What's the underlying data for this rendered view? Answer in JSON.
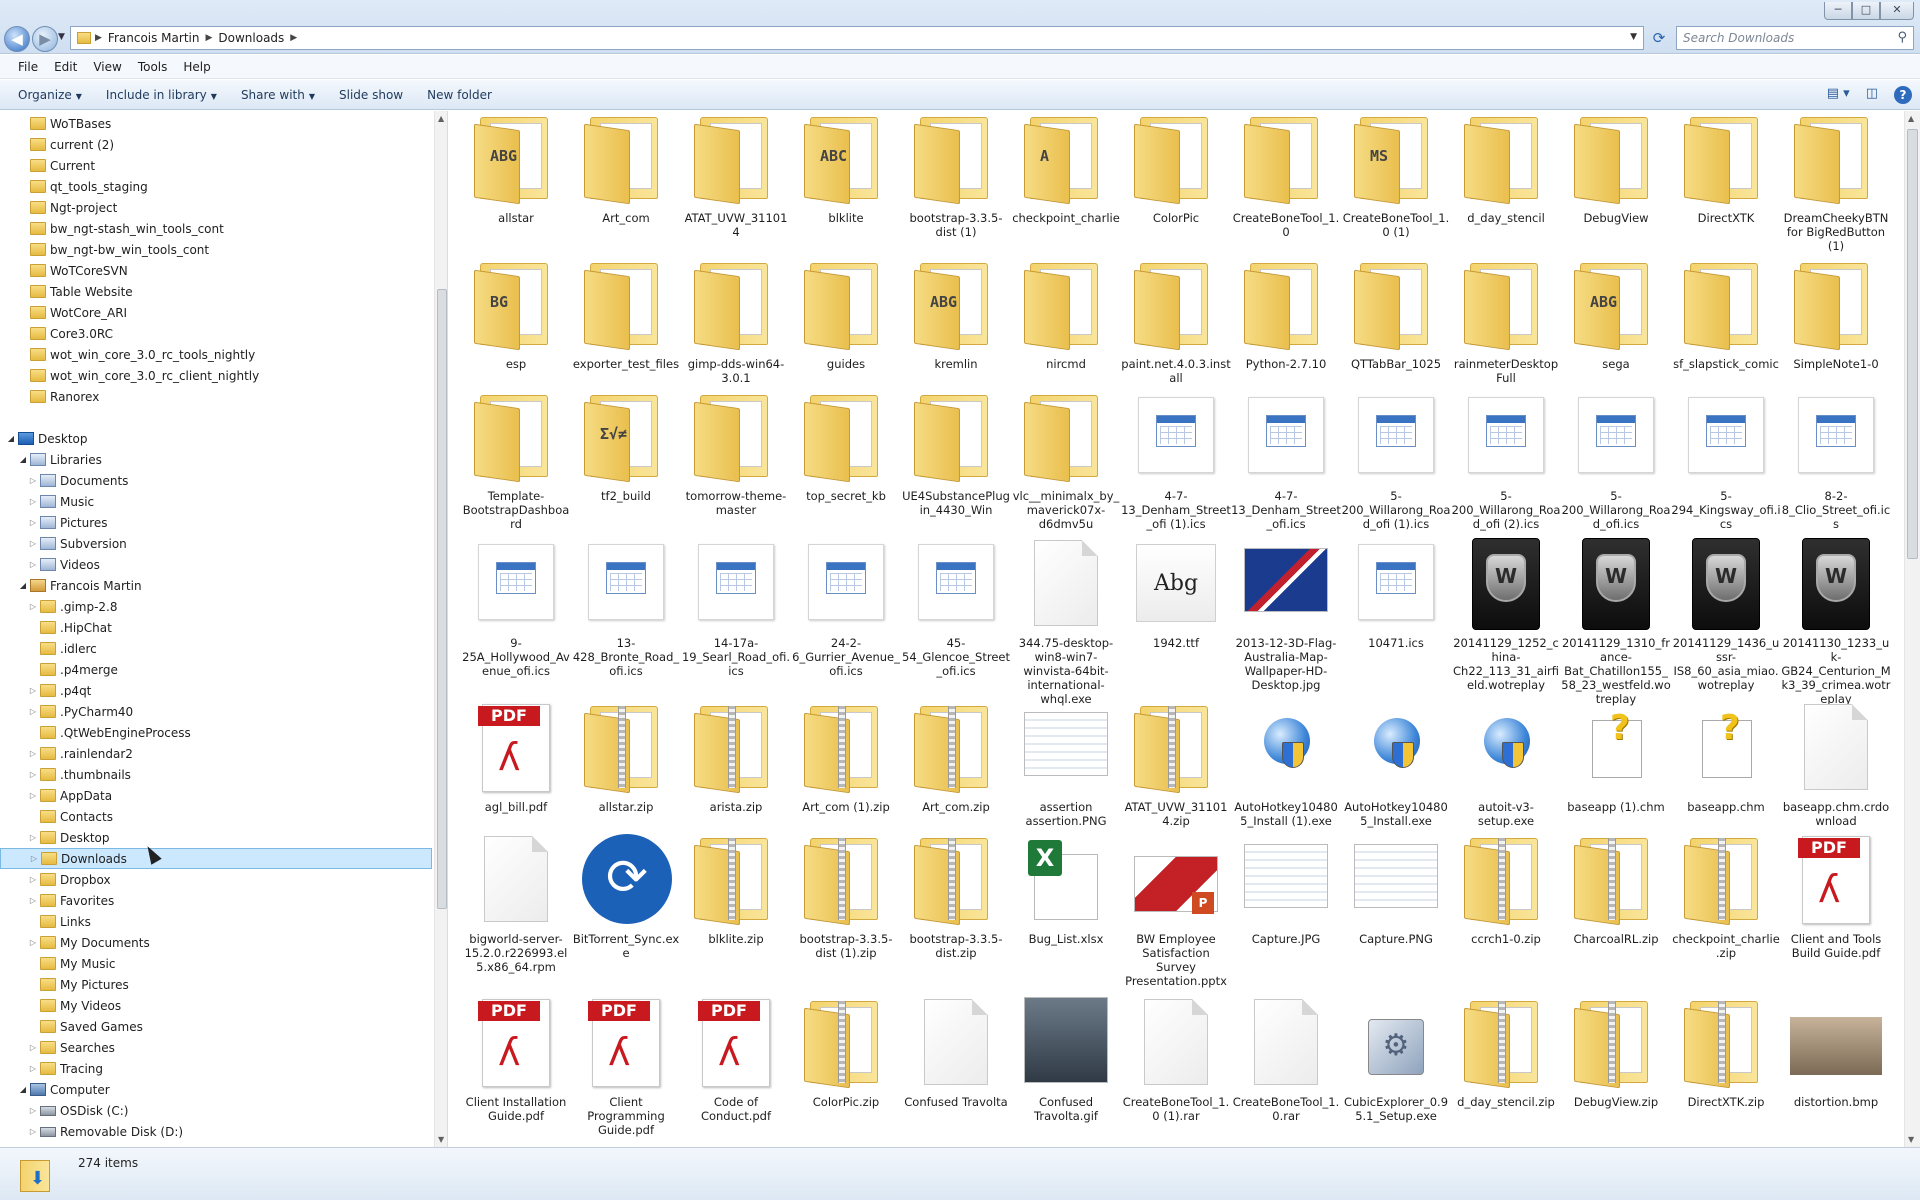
{
  "window": {
    "breadcrumb": [
      "Francois Martin",
      "Downloads"
    ],
    "search_placeholder": "Search Downloads",
    "controls": {
      "minimize": "─",
      "maximize": "□",
      "close": "✕"
    }
  },
  "menubar": [
    "File",
    "Edit",
    "View",
    "Tools",
    "Help"
  ],
  "commandbar": {
    "organize": "Organize",
    "include": "Include in library",
    "share": "Share with",
    "slideshow": "Slide show",
    "newfolder": "New folder"
  },
  "navpane": {
    "selected": "Downloads",
    "items": [
      {
        "label": "WoTBases",
        "level": 1,
        "icon": "folder",
        "arrow": ""
      },
      {
        "label": "current (2)",
        "level": 1,
        "icon": "folder",
        "arrow": ""
      },
      {
        "label": "Current",
        "level": 1,
        "icon": "folder",
        "arrow": ""
      },
      {
        "label": "qt_tools_staging",
        "level": 1,
        "icon": "folder",
        "arrow": ""
      },
      {
        "label": "Ngt-project",
        "level": 1,
        "icon": "folder",
        "arrow": ""
      },
      {
        "label": "bw_ngt-stash_win_tools_cont",
        "level": 1,
        "icon": "folder",
        "arrow": ""
      },
      {
        "label": "bw_ngt-bw_win_tools_cont",
        "level": 1,
        "icon": "folder",
        "arrow": ""
      },
      {
        "label": "WoTCoreSVN",
        "level": 1,
        "icon": "folder",
        "arrow": ""
      },
      {
        "label": "Table Website",
        "level": 1,
        "icon": "folder",
        "arrow": ""
      },
      {
        "label": "WotCore_ARI",
        "level": 1,
        "icon": "folder",
        "arrow": ""
      },
      {
        "label": "Core3.0RC",
        "level": 1,
        "icon": "folder",
        "arrow": ""
      },
      {
        "label": "wot_win_core_3.0_rc_tools_nightly",
        "level": 1,
        "icon": "folder",
        "arrow": ""
      },
      {
        "label": "wot_win_core_3.0_rc_client_nightly",
        "level": 1,
        "icon": "folder",
        "arrow": ""
      },
      {
        "label": "Ranorex",
        "level": 1,
        "icon": "folder",
        "arrow": ""
      },
      {
        "label": "",
        "level": 0,
        "icon": "",
        "arrow": ""
      },
      {
        "label": "Desktop",
        "level": 0,
        "icon": "desk",
        "arrow": "open"
      },
      {
        "label": "Libraries",
        "level": 1,
        "icon": "lib",
        "arrow": "open"
      },
      {
        "label": "Documents",
        "level": 2,
        "icon": "lib",
        "arrow": "closed"
      },
      {
        "label": "Music",
        "level": 2,
        "icon": "lib",
        "arrow": "closed"
      },
      {
        "label": "Pictures",
        "level": 2,
        "icon": "lib",
        "arrow": "closed"
      },
      {
        "label": "Subversion",
        "level": 2,
        "icon": "lib",
        "arrow": "closed"
      },
      {
        "label": "Videos",
        "level": 2,
        "icon": "lib",
        "arrow": "closed"
      },
      {
        "label": "Francois Martin",
        "level": 1,
        "icon": "user",
        "arrow": "open"
      },
      {
        "label": ".gimp-2.8",
        "level": 2,
        "icon": "folder",
        "arrow": "closed"
      },
      {
        "label": ".HipChat",
        "level": 2,
        "icon": "folder",
        "arrow": ""
      },
      {
        "label": ".idlerc",
        "level": 2,
        "icon": "folder",
        "arrow": ""
      },
      {
        "label": ".p4merge",
        "level": 2,
        "icon": "folder",
        "arrow": ""
      },
      {
        "label": ".p4qt",
        "level": 2,
        "icon": "folder",
        "arrow": "closed"
      },
      {
        "label": ".PyCharm40",
        "level": 2,
        "icon": "folder",
        "arrow": "closed"
      },
      {
        "label": ".QtWebEngineProcess",
        "level": 2,
        "icon": "folder",
        "arrow": ""
      },
      {
        "label": ".rainlendar2",
        "level": 2,
        "icon": "folder",
        "arrow": "closed"
      },
      {
        "label": ".thumbnails",
        "level": 2,
        "icon": "folder",
        "arrow": "closed"
      },
      {
        "label": "AppData",
        "level": 2,
        "icon": "folder",
        "arrow": "closed"
      },
      {
        "label": "Contacts",
        "level": 2,
        "icon": "folder",
        "arrow": ""
      },
      {
        "label": "Desktop",
        "level": 2,
        "icon": "folder",
        "arrow": "closed"
      },
      {
        "label": "Downloads",
        "level": 2,
        "icon": "folder",
        "arrow": "closed"
      },
      {
        "label": "Dropbox",
        "level": 2,
        "icon": "folder",
        "arrow": "closed"
      },
      {
        "label": "Favorites",
        "level": 2,
        "icon": "folder",
        "arrow": "closed"
      },
      {
        "label": "Links",
        "level": 2,
        "icon": "folder",
        "arrow": ""
      },
      {
        "label": "My Documents",
        "level": 2,
        "icon": "folder",
        "arrow": "closed"
      },
      {
        "label": "My Music",
        "level": 2,
        "icon": "folder",
        "arrow": ""
      },
      {
        "label": "My Pictures",
        "level": 2,
        "icon": "folder",
        "arrow": ""
      },
      {
        "label": "My Videos",
        "level": 2,
        "icon": "folder",
        "arrow": ""
      },
      {
        "label": "Saved Games",
        "level": 2,
        "icon": "folder",
        "arrow": ""
      },
      {
        "label": "Searches",
        "level": 2,
        "icon": "folder",
        "arrow": "closed"
      },
      {
        "label": "Tracing",
        "level": 2,
        "icon": "folder",
        "arrow": "closed"
      },
      {
        "label": "Computer",
        "level": 1,
        "icon": "comp",
        "arrow": "open"
      },
      {
        "label": "OSDisk (C:)",
        "level": 2,
        "icon": "disk",
        "arrow": "closed"
      },
      {
        "label": "Removable Disk (D:)",
        "level": 2,
        "icon": "disk",
        "arrow": "closed"
      }
    ]
  },
  "files": [
    {
      "name": "allstar",
      "kind": "folder",
      "mark": "ABG"
    },
    {
      "name": "Art_com",
      "kind": "folder",
      "mark": ""
    },
    {
      "name": "ATAT_UVW_311014",
      "kind": "folder",
      "mark": ""
    },
    {
      "name": "blklite",
      "kind": "folder",
      "mark": "ABC"
    },
    {
      "name": "bootstrap-3.3.5-dist (1)",
      "kind": "folder",
      "mark": ""
    },
    {
      "name": "checkpoint_charlie",
      "kind": "folder",
      "mark": "A"
    },
    {
      "name": "ColorPic",
      "kind": "folder",
      "mark": ""
    },
    {
      "name": "CreateBoneTool_1.0",
      "kind": "folder",
      "mark": ""
    },
    {
      "name": "CreateBoneTool_1.0 (1)",
      "kind": "folder",
      "mark": "MS"
    },
    {
      "name": "d_day_stencil",
      "kind": "folder",
      "mark": ""
    },
    {
      "name": "DebugView",
      "kind": "folder",
      "mark": ""
    },
    {
      "name": "DirectXTK",
      "kind": "folder",
      "mark": ""
    },
    {
      "name": "DreamCheekyBTN for BigRedButton (1)",
      "kind": "folder",
      "mark": ""
    },
    {
      "name": "esp",
      "kind": "folder",
      "mark": "BG"
    },
    {
      "name": "exporter_test_files",
      "kind": "folder",
      "mark": ""
    },
    {
      "name": "gimp-dds-win64-3.0.1",
      "kind": "folder",
      "mark": ""
    },
    {
      "name": "guides",
      "kind": "folder",
      "mark": ""
    },
    {
      "name": "kremlin",
      "kind": "folder",
      "mark": "ABG"
    },
    {
      "name": "nircmd",
      "kind": "folder",
      "mark": ""
    },
    {
      "name": "paint.net.4.0.3.install",
      "kind": "folder",
      "mark": ""
    },
    {
      "name": "Python-2.7.10",
      "kind": "folder",
      "mark": ""
    },
    {
      "name": "QTTabBar_1025",
      "kind": "folder",
      "mark": ""
    },
    {
      "name": "rainmeterDesktopFull",
      "kind": "folder",
      "mark": ""
    },
    {
      "name": "sega",
      "kind": "folder",
      "mark": "ABG"
    },
    {
      "name": "sf_slapstick_comic",
      "kind": "folder",
      "mark": ""
    },
    {
      "name": "SimpleNote1-0",
      "kind": "folder",
      "mark": ""
    },
    {
      "name": "Template-BootstrapDashboard",
      "kind": "folder",
      "mark": ""
    },
    {
      "name": "tf2_build",
      "kind": "folder",
      "mark": "Σ√≠"
    },
    {
      "name": "tomorrow-theme-master",
      "kind": "folder",
      "mark": ""
    },
    {
      "name": "top_secret_kb",
      "kind": "folder",
      "mark": ""
    },
    {
      "name": "UE4SubstancePlugin_4430_Win",
      "kind": "folder",
      "mark": ""
    },
    {
      "name": "vlc__minimalx_by_maverick07x-d6dmv5u",
      "kind": "folder",
      "mark": ""
    },
    {
      "name": "4-7-13_Denham_Street_ofi (1).ics",
      "kind": "cal",
      "mark": ""
    },
    {
      "name": "4-7-13_Denham_Street_ofi.ics",
      "kind": "cal",
      "mark": ""
    },
    {
      "name": "5-200_Willarong_Road_ofi (1).ics",
      "kind": "cal",
      "mark": ""
    },
    {
      "name": "5-200_Willarong_Road_ofi (2).ics",
      "kind": "cal",
      "mark": ""
    },
    {
      "name": "5-200_Willarong_Road_ofi.ics",
      "kind": "cal",
      "mark": ""
    },
    {
      "name": "5-294_Kingsway_ofi.ics",
      "kind": "cal",
      "mark": ""
    },
    {
      "name": "8-2-8_Clio_Street_ofi.ics",
      "kind": "cal",
      "mark": ""
    },
    {
      "name": "9-25A_Hollywood_Avenue_ofi.ics",
      "kind": "cal",
      "mark": ""
    },
    {
      "name": "13-428_Bronte_Road_ofi.ics",
      "kind": "cal",
      "mark": ""
    },
    {
      "name": "14-17a-19_Searl_Road_ofi.ics",
      "kind": "cal",
      "mark": ""
    },
    {
      "name": "24-2-6_Gurrier_Avenue_ofi.ics",
      "kind": "cal",
      "mark": ""
    },
    {
      "name": "45-54_Glencoe_Street_ofi.ics",
      "kind": "cal",
      "mark": ""
    },
    {
      "name": "344.75-desktop-win8-win7-winvista-64bit-international-whql.exe",
      "kind": "blank",
      "mark": ""
    },
    {
      "name": "1942.ttf",
      "kind": "font",
      "mark": "Abg"
    },
    {
      "name": "2013-12-3D-Flag-Australia-Map-Wallpaper-HD-Desktop.jpg",
      "kind": "flag",
      "mark": ""
    },
    {
      "name": "10471.ics",
      "kind": "cal",
      "mark": ""
    },
    {
      "name": "20141129_1252_china-Ch22_113_31_airfield.wotreplay",
      "kind": "wot",
      "mark": ""
    },
    {
      "name": "20141129_1310_france-Bat_Chatillon155_58_23_westfeld.wotreplay",
      "kind": "wot",
      "mark": ""
    },
    {
      "name": "20141129_1436_ussr-IS8_60_asia_miao.wotreplay",
      "kind": "wot",
      "mark": ""
    },
    {
      "name": "20141130_1233_uk-GB24_Centurion_Mk3_39_crimea.wotreplay",
      "kind": "wot",
      "mark": ""
    },
    {
      "name": "agl_bill.pdf",
      "kind": "pdf",
      "mark": "PDF"
    },
    {
      "name": "allstar.zip",
      "kind": "zip",
      "mark": ""
    },
    {
      "name": "arista.zip",
      "kind": "zip",
      "mark": ""
    },
    {
      "name": "Art_com (1).zip",
      "kind": "zip",
      "mark": ""
    },
    {
      "name": "Art_com.zip",
      "kind": "zip",
      "mark": ""
    },
    {
      "name": "assertion assertion.PNG",
      "kind": "shot",
      "mark": ""
    },
    {
      "name": "ATAT_UVW_311014.zip",
      "kind": "zip",
      "mark": ""
    },
    {
      "name": "AutoHotkey104805_Install (1).exe",
      "kind": "globe",
      "mark": ""
    },
    {
      "name": "AutoHotkey104805_Install.exe",
      "kind": "globe",
      "mark": ""
    },
    {
      "name": "autoit-v3-setup.exe",
      "kind": "globe",
      "mark": ""
    },
    {
      "name": "baseapp (1).chm",
      "kind": "chm",
      "mark": "?"
    },
    {
      "name": "baseapp.chm",
      "kind": "chm",
      "mark": "?"
    },
    {
      "name": "baseapp.chm.crdownload",
      "kind": "blank",
      "mark": ""
    },
    {
      "name": "bigworld-server-15.2.0.r226993.el5.x86_64.rpm",
      "kind": "blank",
      "mark": ""
    },
    {
      "name": "BitTorrent_Sync.exe",
      "kind": "bt",
      "mark": ""
    },
    {
      "name": "blklite.zip",
      "kind": "zip",
      "mark": ""
    },
    {
      "name": "bootstrap-3.3.5-dist (1).zip",
      "kind": "zip",
      "mark": ""
    },
    {
      "name": "bootstrap-3.3.5-dist.zip",
      "kind": "zip",
      "mark": ""
    },
    {
      "name": "Bug_List.xlsx",
      "kind": "xls",
      "mark": "X"
    },
    {
      "name": "BW Employee Satisfaction Survey Presentation.pptx",
      "kind": "ppt",
      "mark": "P"
    },
    {
      "name": "Capture.JPG",
      "kind": "shot",
      "mark": ""
    },
    {
      "name": "Capture.PNG",
      "kind": "shot",
      "mark": ""
    },
    {
      "name": "ccrch1-0.zip",
      "kind": "zip",
      "mark": ""
    },
    {
      "name": "CharcoalRL.zip",
      "kind": "zip",
      "mark": ""
    },
    {
      "name": "checkpoint_charlie.zip",
      "kind": "zip",
      "mark": ""
    },
    {
      "name": "Client and Tools Build Guide.pdf",
      "kind": "pdf",
      "mark": "PDF"
    },
    {
      "name": "Client Installation Guide.pdf",
      "kind": "pdf",
      "mark": "PDF"
    },
    {
      "name": "Client Programming Guide.pdf",
      "kind": "pdf",
      "mark": "PDF"
    },
    {
      "name": "Code of Conduct.pdf",
      "kind": "pdf",
      "mark": "PDF"
    },
    {
      "name": "ColorPic.zip",
      "kind": "zip",
      "mark": ""
    },
    {
      "name": "Confused Travolta",
      "kind": "blank",
      "mark": ""
    },
    {
      "name": "Confused Travolta.gif",
      "kind": "photo",
      "mark": ""
    },
    {
      "name": "CreateBoneTool_1.0 (1).rar",
      "kind": "blank",
      "mark": ""
    },
    {
      "name": "CreateBoneTool_1.0.rar",
      "kind": "blank",
      "mark": ""
    },
    {
      "name": "CubicExplorer_0.95.1_Setup.exe",
      "kind": "setup",
      "mark": ""
    },
    {
      "name": "d_day_stencil.zip",
      "kind": "zip",
      "mark": ""
    },
    {
      "name": "DebugView.zip",
      "kind": "zip",
      "mark": ""
    },
    {
      "name": "DirectXTK.zip",
      "kind": "zip",
      "mark": ""
    },
    {
      "name": "distortion.bmp",
      "kind": "tank",
      "mark": ""
    }
  ],
  "status": {
    "count": "274 items"
  }
}
